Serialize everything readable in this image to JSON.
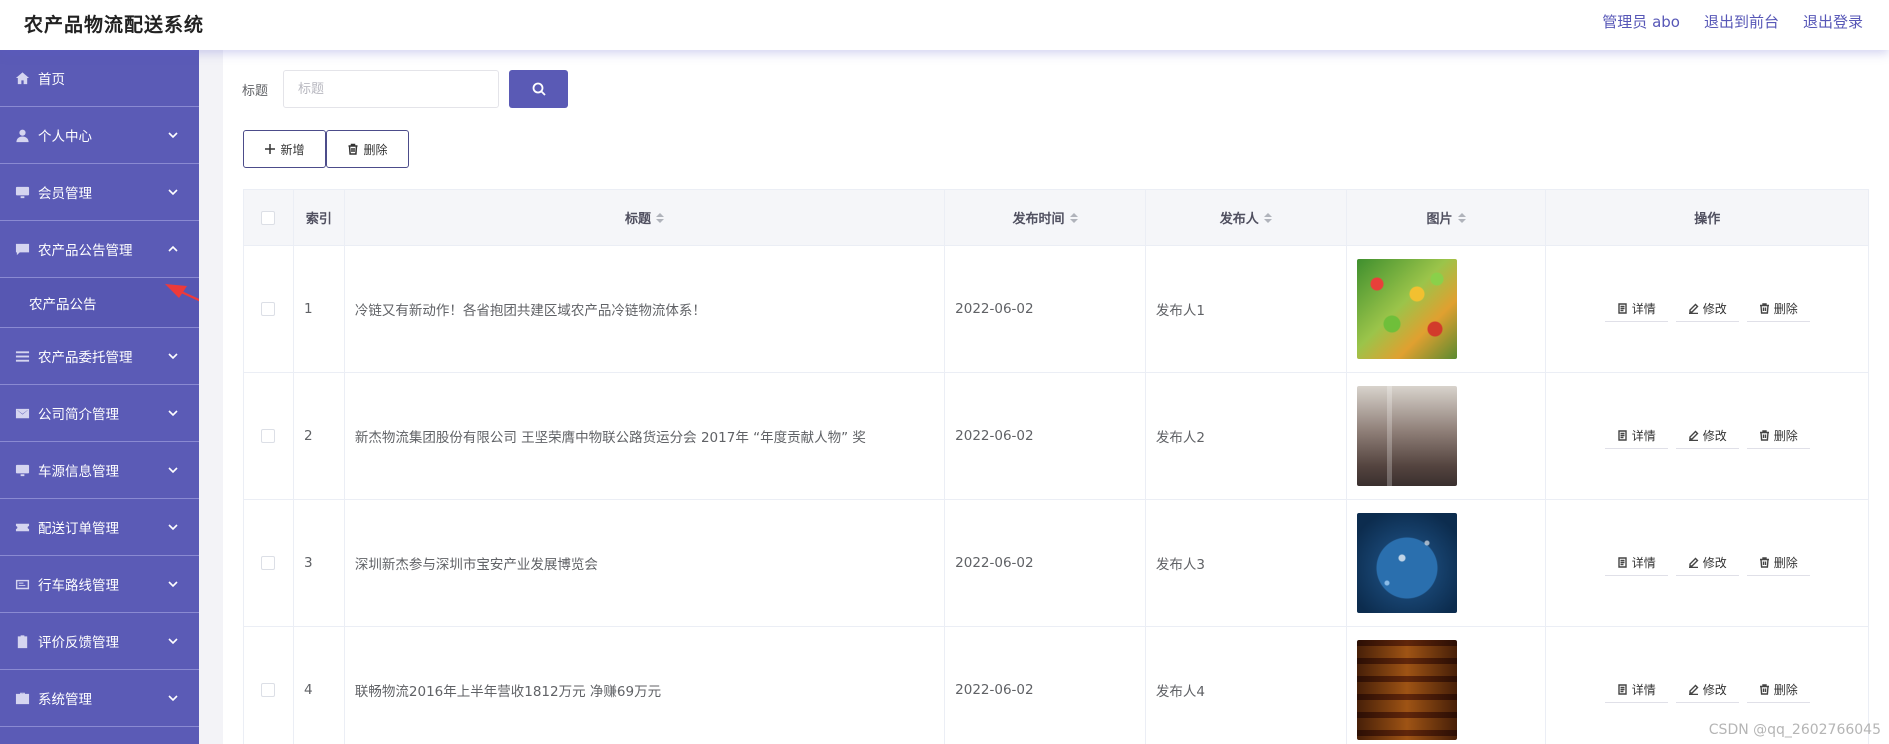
{
  "header": {
    "app_title": "农产品物流配送系统",
    "admin": "管理员 abo",
    "front": "退出到前台",
    "logout": "退出登录"
  },
  "sidebar": {
    "items": [
      {
        "label": "首页",
        "icon": "home-icon",
        "expandable": false
      },
      {
        "label": "个人中心",
        "icon": "user-icon",
        "expandable": true
      },
      {
        "label": "会员管理",
        "icon": "monitor-icon",
        "expandable": true
      },
      {
        "label": "农产品公告管理",
        "icon": "message-icon",
        "expandable": true,
        "expanded": true
      },
      {
        "label": "农产品委托管理",
        "icon": "list-icon",
        "expandable": true
      },
      {
        "label": "公司简介管理",
        "icon": "mail-icon",
        "expandable": true
      },
      {
        "label": "车源信息管理",
        "icon": "monitor-icon",
        "expandable": true
      },
      {
        "label": "配送订单管理",
        "icon": "ticket-icon",
        "expandable": true
      },
      {
        "label": "行车路线管理",
        "icon": "card-icon",
        "expandable": true
      },
      {
        "label": "评价反馈管理",
        "icon": "clipboard-icon",
        "expandable": true
      },
      {
        "label": "系统管理",
        "icon": "briefcase-icon",
        "expandable": true
      }
    ],
    "sub_item": "农产品公告"
  },
  "search": {
    "label": "标题",
    "placeholder": "标题",
    "value": ""
  },
  "toolbar": {
    "add_label": "新增",
    "delete_label": "删除"
  },
  "table": {
    "columns": [
      "索引",
      "标题",
      "发布时间",
      "发布人",
      "图片",
      "操作"
    ],
    "rows": [
      {
        "index": "1",
        "title": "冷链又有新动作！各省抱团共建区域农产品冷链物流体系！",
        "time": "2022-06-02",
        "publisher": "发布人1",
        "image": "vegetables"
      },
      {
        "index": "2",
        "title": "新杰物流集团股份有限公司 王坚荣膺中物联公路货运分会 2017年 “年度贡献人物” 奖",
        "time": "2022-06-02",
        "publisher": "发布人2",
        "image": "warehouse"
      },
      {
        "index": "3",
        "title": "深圳新杰参与深圳市宝安产业发展博览会",
        "time": "2022-06-02",
        "publisher": "发布人3",
        "image": "globe"
      },
      {
        "index": "4",
        "title": "联畅物流2016年上半年营收1812万元 净赚69万元",
        "time": "2022-06-02",
        "publisher": "发布人4",
        "image": "shelves"
      }
    ],
    "row_actions": {
      "detail": "详情",
      "edit": "修改",
      "delete": "删除"
    }
  },
  "watermark": "CSDN @qq_2602766045"
}
